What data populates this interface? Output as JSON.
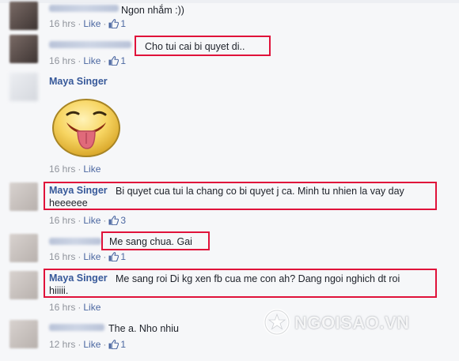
{
  "comments": [
    {
      "text": "Ngon nhắm :))",
      "time": "16 hrs",
      "like_label": "Like",
      "likes": "1"
    },
    {
      "text": "Cho tui cai bi quyet di..",
      "time": "16 hrs",
      "like_label": "Like",
      "likes": "1"
    },
    {
      "name": "Maya Singer",
      "time": "16 hrs",
      "like_label": "Like"
    },
    {
      "name": "Maya Singer",
      "text_line1": "Bi quyet cua tui la chang co bi quyet j ca. Minh tu nhien la vay day",
      "text_line2": "heeeeee",
      "time": "16 hrs",
      "like_label": "Like",
      "likes": "3"
    },
    {
      "text": "Me sang chua. Gai",
      "time": "16 hrs",
      "like_label": "Like",
      "likes": "1"
    },
    {
      "name": "Maya Singer",
      "text_line1": "Me sang roi Di kg xen fb cua me con ah? Dang ngoi nghich dt roi",
      "text_line2": "hiiiii.",
      "time": "16 hrs",
      "like_label": "Like"
    },
    {
      "text": "The a. Nho nhiu",
      "time": "12 hrs",
      "like_label": "Like",
      "likes": "1"
    }
  ],
  "watermark": "NGOISAO.VN",
  "colors": {
    "link": "#365899",
    "meta": "#90949c",
    "highlight": "#e0123a",
    "background": "#f6f7f9"
  },
  "icons": [
    "thumbs-up-icon",
    "tongue-out-emoji-sticker"
  ]
}
